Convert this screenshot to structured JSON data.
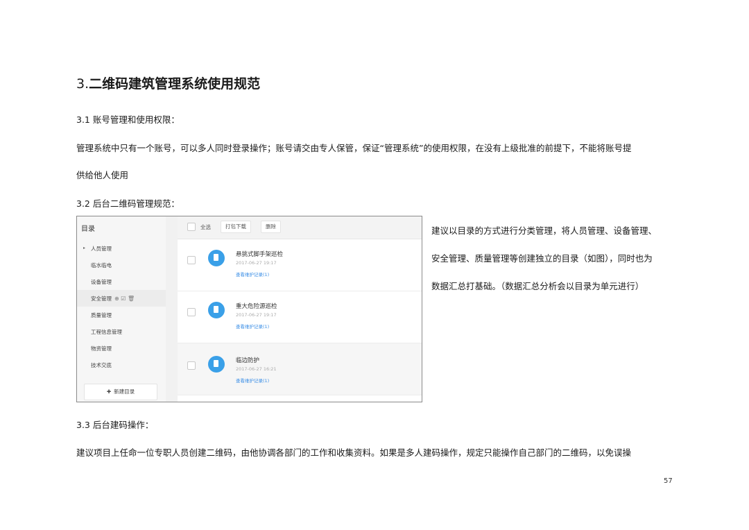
{
  "document": {
    "heading_num": "3.",
    "heading_text": "二维码建筑管理系统使用规范",
    "s31_title": "3.1 账号管理和使用权限：",
    "s31_line1": "管理系统中只有一个账号，可以多人同时登录操作；账号请交由专人保管，保证“管理系统”的使用权限，在没有上级批准的前提下，不能将账号提",
    "s31_line2": "供给他人使用",
    "s32_title": "3.2 后台二维码管理规范：",
    "s32_side1": "建议以目录的方式进行分类管理，将人员管理、设备管理、",
    "s32_side2": "安全管理、质量管理等创建独立的目录（如图），同时也为",
    "s32_side3": "数据汇总打基础。（数据汇总分析会以目录为单元进行）",
    "s33_title": "3.3 后台建码操作：",
    "s33_line1": "建议项目上任命一位专职人员创建二维码，由他协调各部门的工作和收集资料。如果是多人建码操作，规定只能操作自己部门的二维码，以免误操",
    "page_number": "57"
  },
  "screenshot": {
    "sidebar": {
      "title": "目录",
      "items": [
        "人员管理",
        "临水临电",
        "设备管理",
        "安全管理",
        "质量管理",
        "工程信息管理",
        "物资管理",
        "技术交底"
      ],
      "active_ops": "⊕ ☑ 🗑",
      "new_button": "新建目录"
    },
    "toolbar": {
      "select_all": "全选",
      "download": "打包下载",
      "delete": "删除"
    },
    "rows": [
      {
        "name": "悬挑式脚手架巡检",
        "date": "2017-06-27 19:17",
        "link": "查看维护记录(1)"
      },
      {
        "name": "重大危险源巡检",
        "date": "2017-06-27 19:17",
        "link": "查看维护记录(1)"
      },
      {
        "name": "临边防护",
        "date": "2017-06-27 16:21",
        "link": "查看维护记录(1)"
      }
    ],
    "colors": {
      "accent": "#3aa0e8",
      "link": "#3a8ee6"
    }
  }
}
